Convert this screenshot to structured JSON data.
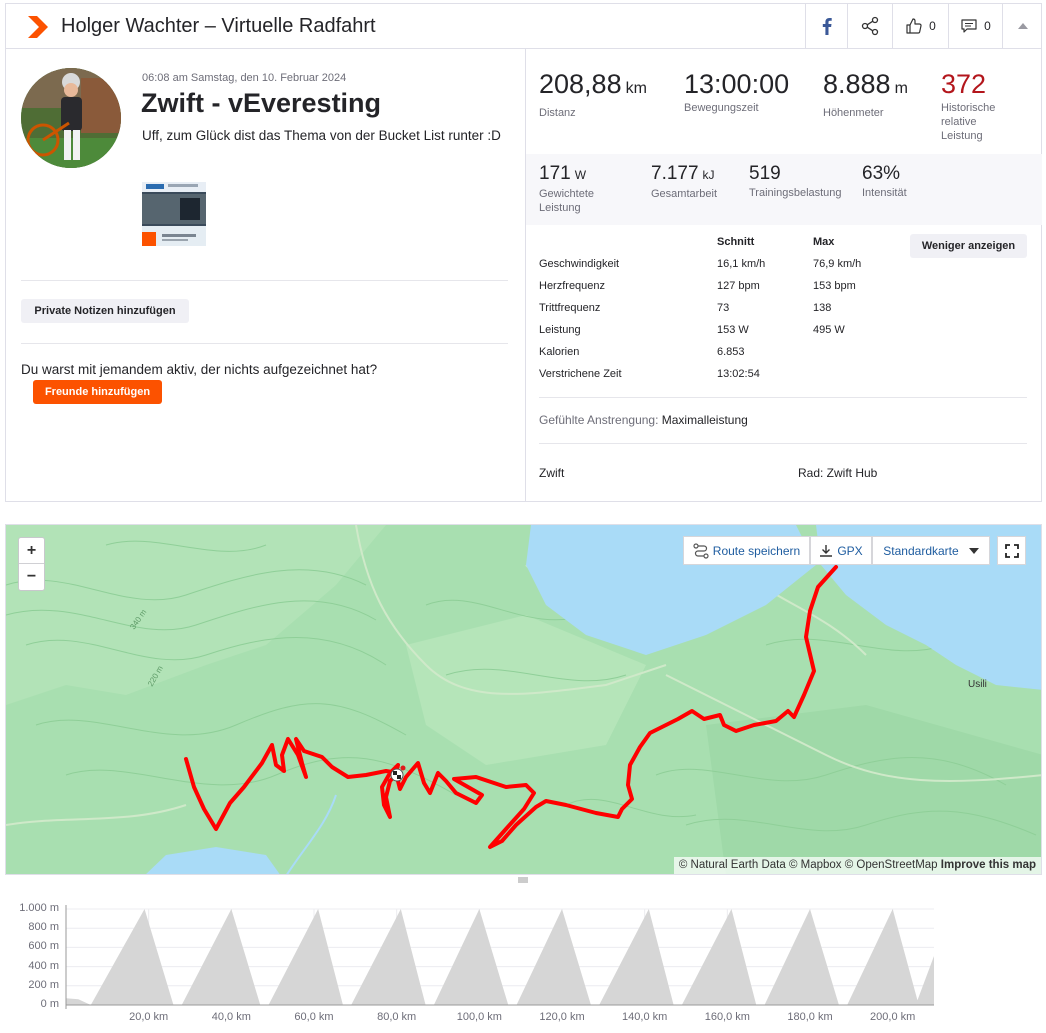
{
  "header": {
    "title": "Holger Wachter – Virtuelle Radfahrt",
    "kudos_count": "0",
    "comment_count": "0",
    "icons": [
      "strava-logo-icon",
      "facebook-icon",
      "share-icon",
      "thumbs-up-icon",
      "comment-icon",
      "caret-up-icon"
    ]
  },
  "activity": {
    "date": "06:08 am Samstag, den 10. Februar 2024",
    "name": "Zwift - vEveresting",
    "description": "Uff, zum Glück dist das Thema von der Bucket List runter :D"
  },
  "left": {
    "private_notes_button": "Private Notizen hinzufügen",
    "question": "Du warst mit jemandem aktiv, der nichts aufgezeichnet hat?",
    "add_friends_button": "Freunde hinzufügen"
  },
  "stats_primary": [
    {
      "value": "208,88",
      "unit": "km",
      "label": "Distanz"
    },
    {
      "value": "13:00:00",
      "unit": "",
      "label": "Bewegungszeit"
    },
    {
      "value": "8.888",
      "unit": "m",
      "label": "Höhenmeter"
    },
    {
      "value": "372",
      "unit": "",
      "label": "Historische relative Leistung"
    }
  ],
  "stats_secondary": [
    {
      "value": "171",
      "unit": "W",
      "label": "Gewichtete Leistung"
    },
    {
      "value": "7.177",
      "unit": "kJ",
      "label": "Gesamtarbeit"
    },
    {
      "value": "519",
      "unit": "",
      "label": "Trainingsbelastung"
    },
    {
      "value": "63%",
      "unit": "",
      "label": "Intensität"
    }
  ],
  "details": {
    "col_avg": "Schnitt",
    "col_max": "Max",
    "less_button": "Weniger anzeigen",
    "rows": [
      {
        "label": "Geschwindigkeit",
        "avg": "16,1 km/h",
        "max": "76,9 km/h"
      },
      {
        "label": "Herzfrequenz",
        "avg": "127 bpm",
        "max": "153 bpm"
      },
      {
        "label": "Trittfrequenz",
        "avg": "73",
        "max": "138"
      },
      {
        "label": "Leistung",
        "avg": "153 W",
        "max": "495 W"
      },
      {
        "label": "Kalorien",
        "avg": "6.853",
        "max": ""
      },
      {
        "label": "Verstrichene Zeit",
        "avg": "13:02:54",
        "max": ""
      }
    ],
    "effort_label": "Gefühlte Anstrengung:",
    "effort_value": "Maximalleistung",
    "device": "Zwift",
    "bike": "Rad: Zwift Hub"
  },
  "map": {
    "zoom_in": "+",
    "zoom_out": "−",
    "save_route": "Route speichern",
    "gpx": "GPX",
    "map_type": "Standardkarte",
    "attribution": "© Natural Earth Data © Mapbox © OpenStreetMap",
    "improve": "Improve this map",
    "place_label": "Usili",
    "contour_labels": [
      "340 m",
      "220 m"
    ],
    "colors": {
      "land": "#a7e0b0",
      "water": "#a9dbf7",
      "route": "#ff0000"
    }
  },
  "chart_data": {
    "type": "area",
    "title": "",
    "xlabel": "",
    "ylabel": "",
    "x_unit": "km",
    "y_unit": "m",
    "xlim": [
      0,
      210
    ],
    "ylim": [
      0,
      1000
    ],
    "x_ticks": [
      "20,0 km",
      "40,0 km",
      "60,0 km",
      "80,0 km",
      "100,0 km",
      "120,0 km",
      "140,0 km",
      "160,0 km",
      "180,0 km",
      "200,0 km"
    ],
    "x_tick_values": [
      20,
      40,
      60,
      80,
      100,
      120,
      140,
      160,
      180,
      200
    ],
    "y_ticks": [
      "1.000 m",
      "800 m",
      "600 m",
      "400 m",
      "200 m",
      "0 m"
    ],
    "y_tick_values": [
      1000,
      800,
      600,
      400,
      200,
      0
    ],
    "grid": true,
    "fill_color": "#d6d6d6",
    "series": [
      {
        "x": [
          0,
          3,
          6,
          19,
          26,
          28,
          40,
          47,
          49,
          61,
          67,
          69,
          81,
          87,
          89,
          100,
          107,
          109,
          120,
          127,
          129,
          141,
          147,
          149,
          161,
          167,
          169,
          180,
          187,
          189,
          200,
          206,
          210
        ],
        "y": [
          70,
          60,
          0,
          1000,
          0,
          0,
          1000,
          0,
          0,
          1000,
          0,
          0,
          1000,
          0,
          0,
          1000,
          0,
          0,
          1000,
          0,
          0,
          1000,
          0,
          0,
          1000,
          0,
          0,
          1000,
          0,
          0,
          1000,
          50,
          510
        ]
      }
    ]
  }
}
